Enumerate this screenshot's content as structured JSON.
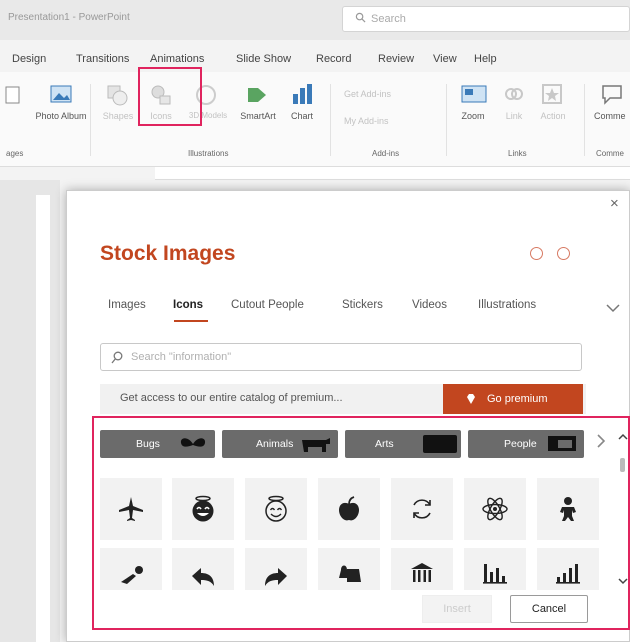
{
  "window": {
    "title": "Presentation1 - PowerPoint",
    "search_placeholder": "Search"
  },
  "ribbon_tabs": [
    "Design",
    "Transitions",
    "Animations",
    "Slide Show",
    "Record",
    "Review",
    "View",
    "Help"
  ],
  "ribbon": {
    "photo_album": "Photo Album",
    "shapes": "Shapes",
    "icons": "Icons",
    "models": "3D Models",
    "smartart": "SmartArt",
    "chart": "Chart",
    "get_addins": "Get Add-ins",
    "my_addins": "My Add-ins",
    "zoom": "Zoom",
    "link": "Link",
    "action": "Action",
    "comment": "Comme",
    "groups": {
      "images": "ages",
      "illustrations": "Illustrations",
      "addins": "Add-ins",
      "links": "Links",
      "comments": "Comme"
    }
  },
  "dialog": {
    "title": "Stock Images",
    "tabs": [
      "Images",
      "Icons",
      "Cutout People",
      "Stickers",
      "Videos",
      "Illustrations"
    ],
    "active_tab": "Icons",
    "search_placeholder": "Search \"information\"",
    "promo_text": "Get access to our entire catalog of premium...",
    "premium_label": "Go premium",
    "categories": [
      "Bugs",
      "Animals",
      "Arts",
      "People"
    ],
    "icons": [
      {
        "name": "airplane-icon"
      },
      {
        "name": "smiling-angel-face-icon"
      },
      {
        "name": "angel-face-outline-icon"
      },
      {
        "name": "apple-icon"
      },
      {
        "name": "refresh-arrows-icon"
      },
      {
        "name": "atom-icon"
      },
      {
        "name": "baby-icon"
      },
      {
        "name": "baby-crawling-icon"
      },
      {
        "name": "arrow-back-icon"
      },
      {
        "name": "arrow-forward-icon"
      },
      {
        "name": "bag-icon"
      },
      {
        "name": "bank-icon"
      },
      {
        "name": "bar-chart-icon"
      },
      {
        "name": "bar-chart-ascending-icon"
      }
    ],
    "insert_label": "Insert",
    "cancel_label": "Cancel",
    "close_glyph": "×"
  },
  "colors": {
    "accent": "#c2461f",
    "highlight": "#e0245e",
    "category_bg": "#6b6b6b"
  }
}
